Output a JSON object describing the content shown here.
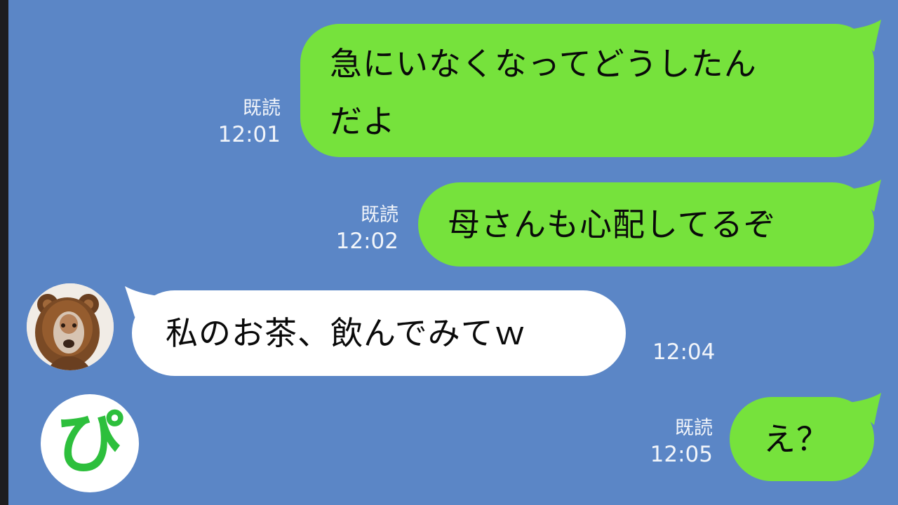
{
  "chat": {
    "messages": [
      {
        "direction": "outgoing",
        "lines": [
          "急にいなくなってどうしたん",
          "だよ"
        ],
        "read_label": "既読",
        "time": "12:01"
      },
      {
        "direction": "outgoing",
        "lines": [
          "母さんも心配してるぞ"
        ],
        "read_label": "既読",
        "time": "12:02"
      },
      {
        "direction": "incoming",
        "lines": [
          "私のお茶、飲んでみてｗ"
        ],
        "time": "12:04"
      },
      {
        "direction": "outgoing",
        "lines": [
          "え？"
        ],
        "read_label": "既読",
        "time": "12:05"
      }
    ]
  },
  "avatar": {
    "icon": "lion-costume-dog-avatar"
  },
  "logo": {
    "text": "ぴ",
    "color": "#2dbf3c"
  },
  "colors": {
    "background": "#5b86c6",
    "outgoing_bubble": "#76e23c",
    "incoming_bubble": "#ffffff",
    "meta_text": "#ffffff"
  }
}
